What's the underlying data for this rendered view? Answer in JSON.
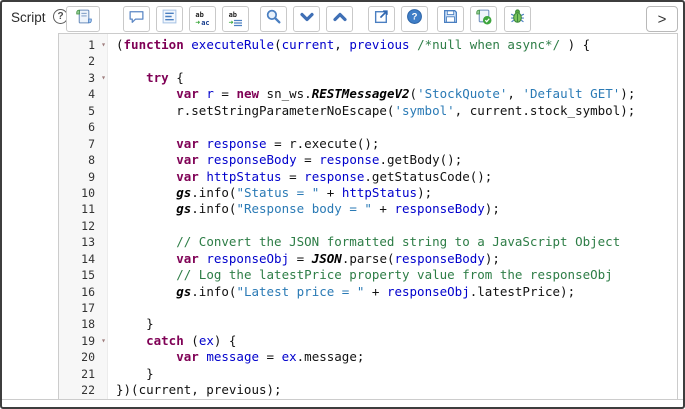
{
  "window": {
    "field_label": "Script"
  },
  "toolbar": {
    "expand_label": ">",
    "replace_icon": {
      "top": "ab",
      "bottom": "ac"
    },
    "replace_all_icon": {
      "top": "ab"
    },
    "buttons": [
      {
        "name": "script-fields",
        "icon": "script-icon"
      },
      {
        "name": "toggle-comment",
        "icon": "comment-icon"
      },
      {
        "name": "format-code",
        "icon": "format-code-icon"
      },
      {
        "name": "replace",
        "icon": "replace-icon"
      },
      {
        "name": "replace-all",
        "icon": "replace-all-icon"
      },
      {
        "name": "search",
        "icon": "search-icon"
      },
      {
        "name": "find-next",
        "icon": "chevron-down-icon"
      },
      {
        "name": "find-previous",
        "icon": "chevron-up-icon"
      },
      {
        "name": "open-in-new-window",
        "icon": "popout-icon"
      },
      {
        "name": "help",
        "icon": "help-icon"
      },
      {
        "name": "save",
        "icon": "save-icon"
      },
      {
        "name": "syntax-check",
        "icon": "syntax-check-icon"
      },
      {
        "name": "debug",
        "icon": "debug-icon"
      }
    ]
  },
  "colors": {
    "keyword": "#7f0055",
    "string": "#2a7ab5",
    "comment": "#2d7d46",
    "local_variable": "#0000cc",
    "global_object": "#000000",
    "gutter_background": "#f7f7f7",
    "icon_blue": "#4a7fc1",
    "icon_green": "#3c9a3c"
  },
  "editor": {
    "lines": [
      {
        "fold": true,
        "t": [
          [
            "p",
            "("
          ],
          [
            "k",
            "function"
          ],
          [
            "p",
            " "
          ],
          [
            "d",
            "executeRule"
          ],
          [
            "p",
            "("
          ],
          [
            "d",
            "current"
          ],
          [
            "p",
            ", "
          ],
          [
            "d",
            "previous"
          ],
          [
            "p",
            " "
          ],
          [
            "c",
            "/*null when async*/"
          ],
          [
            "p",
            " ) {"
          ]
        ]
      },
      {
        "t": []
      },
      {
        "fold": true,
        "t": [
          [
            "p",
            "    "
          ],
          [
            "k",
            "try"
          ],
          [
            "p",
            " {"
          ]
        ]
      },
      {
        "t": [
          [
            "p",
            "        "
          ],
          [
            "k",
            "var"
          ],
          [
            "p",
            " "
          ],
          [
            "d",
            "r"
          ],
          [
            "p",
            " = "
          ],
          [
            "k",
            "new"
          ],
          [
            "p",
            " sn_ws."
          ],
          [
            "g",
            "RESTMessageV2"
          ],
          [
            "p",
            "("
          ],
          [
            "s",
            "'StockQuote'"
          ],
          [
            "p",
            ", "
          ],
          [
            "s",
            "'Default GET'"
          ],
          [
            "p",
            ");"
          ]
        ]
      },
      {
        "t": [
          [
            "p",
            "        r.setStringParameterNoEscape("
          ],
          [
            "s",
            "'symbol'"
          ],
          [
            "p",
            ", current.stock_symbol);"
          ]
        ]
      },
      {
        "t": []
      },
      {
        "t": [
          [
            "p",
            "        "
          ],
          [
            "k",
            "var"
          ],
          [
            "p",
            " "
          ],
          [
            "d",
            "response"
          ],
          [
            "p",
            " = r.execute();"
          ]
        ]
      },
      {
        "t": [
          [
            "p",
            "        "
          ],
          [
            "k",
            "var"
          ],
          [
            "p",
            " "
          ],
          [
            "d",
            "responseBody"
          ],
          [
            "p",
            " = "
          ],
          [
            "d",
            "response"
          ],
          [
            "p",
            ".getBody();"
          ]
        ]
      },
      {
        "t": [
          [
            "p",
            "        "
          ],
          [
            "k",
            "var"
          ],
          [
            "p",
            " "
          ],
          [
            "d",
            "httpStatus"
          ],
          [
            "p",
            " = "
          ],
          [
            "d",
            "response"
          ],
          [
            "p",
            ".getStatusCode();"
          ]
        ]
      },
      {
        "t": [
          [
            "p",
            "        "
          ],
          [
            "g",
            "gs"
          ],
          [
            "p",
            ".info("
          ],
          [
            "s",
            "\"Status = \""
          ],
          [
            "p",
            " + "
          ],
          [
            "d",
            "httpStatus"
          ],
          [
            "p",
            ");"
          ]
        ]
      },
      {
        "t": [
          [
            "p",
            "        "
          ],
          [
            "g",
            "gs"
          ],
          [
            "p",
            ".info("
          ],
          [
            "s",
            "\"Response body = \""
          ],
          [
            "p",
            " + "
          ],
          [
            "d",
            "responseBody"
          ],
          [
            "p",
            ");"
          ]
        ]
      },
      {
        "t": []
      },
      {
        "t": [
          [
            "p",
            "        "
          ],
          [
            "c",
            "// Convert the JSON formatted string to a JavaScript Object"
          ]
        ]
      },
      {
        "t": [
          [
            "p",
            "        "
          ],
          [
            "k",
            "var"
          ],
          [
            "p",
            " "
          ],
          [
            "d",
            "responseObj"
          ],
          [
            "p",
            " = "
          ],
          [
            "g",
            "JSON"
          ],
          [
            "p",
            ".parse("
          ],
          [
            "d",
            "responseBody"
          ],
          [
            "p",
            ");"
          ]
        ]
      },
      {
        "t": [
          [
            "p",
            "        "
          ],
          [
            "c",
            "// Log the latestPrice property value from the responseObj"
          ]
        ]
      },
      {
        "t": [
          [
            "p",
            "        "
          ],
          [
            "g",
            "gs"
          ],
          [
            "p",
            ".info("
          ],
          [
            "s",
            "\"Latest price = \""
          ],
          [
            "p",
            " + "
          ],
          [
            "d",
            "responseObj"
          ],
          [
            "p",
            ".latestPrice);"
          ]
        ]
      },
      {
        "t": []
      },
      {
        "t": [
          [
            "p",
            "    }"
          ]
        ]
      },
      {
        "fold": true,
        "t": [
          [
            "p",
            "    "
          ],
          [
            "k",
            "catch"
          ],
          [
            "p",
            " ("
          ],
          [
            "d",
            "ex"
          ],
          [
            "p",
            ") {"
          ]
        ]
      },
      {
        "t": [
          [
            "p",
            "        "
          ],
          [
            "k",
            "var"
          ],
          [
            "p",
            " "
          ],
          [
            "d",
            "message"
          ],
          [
            "p",
            " = "
          ],
          [
            "d",
            "ex"
          ],
          [
            "p",
            ".message;"
          ]
        ]
      },
      {
        "t": [
          [
            "p",
            "    }"
          ]
        ]
      },
      {
        "t": [
          [
            "p",
            "})(current, previous);"
          ]
        ]
      }
    ]
  }
}
